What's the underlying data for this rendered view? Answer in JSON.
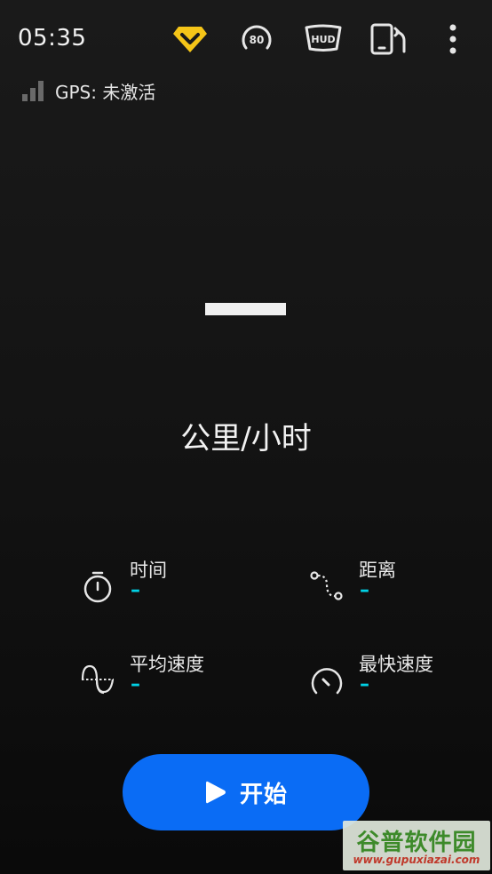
{
  "status": {
    "time": "05:35"
  },
  "toolbar": {
    "speed_badge_text": "80",
    "hud_text": "HUD"
  },
  "gps": {
    "label": "GPS: 未激活"
  },
  "speedometer": {
    "value": "—",
    "unit": "公里/小时"
  },
  "stats": [
    {
      "label": "时间",
      "value": "–"
    },
    {
      "label": "距离",
      "value": "–"
    },
    {
      "label": "平均速度",
      "value": "–"
    },
    {
      "label": "最快速度",
      "value": "–"
    }
  ],
  "start_button": {
    "label": "开始"
  },
  "watermark": {
    "title": "谷普软件园",
    "url": "www.gupuxiazai.com"
  },
  "colors": {
    "accent_blue": "#0a6cf5",
    "value_cyan": "#00d2e6",
    "premium_yellow": "#f5c518"
  }
}
